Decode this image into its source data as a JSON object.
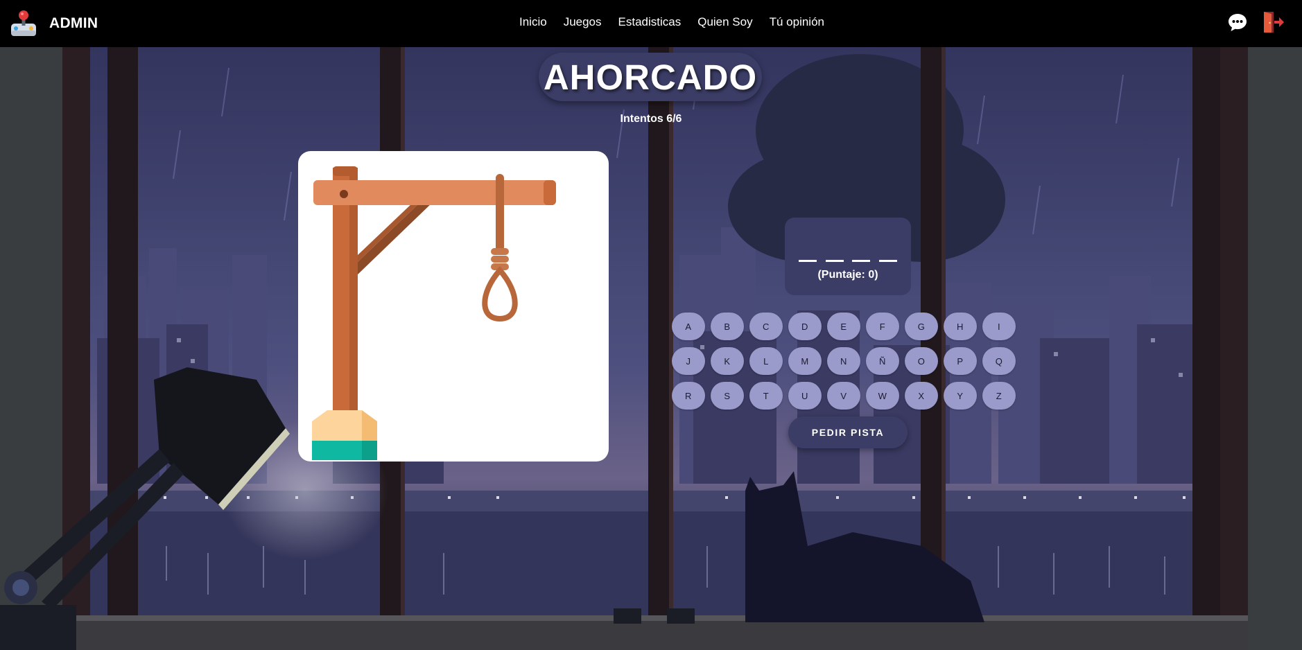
{
  "navbar": {
    "brand": "ADMIN",
    "brand_icon": "joystick-icon",
    "links": [
      "Inicio",
      "Juegos",
      "Estadisticas",
      "Quien Soy",
      "Tú opinión"
    ],
    "icons": [
      "chat-bubble-icon",
      "exit-door-icon"
    ],
    "accent_color": "#e23b3b"
  },
  "game": {
    "title": "AHORCADO",
    "attempts": "Intentos 6/6",
    "word_slots": 4,
    "score": "(Puntaje: 0)",
    "keyboard_rows": [
      [
        "A",
        "B",
        "C",
        "D",
        "E",
        "F",
        "G",
        "H",
        "I"
      ],
      [
        "J",
        "K",
        "L",
        "M",
        "N",
        "Ñ",
        "O",
        "P",
        "Q"
      ],
      [
        "R",
        "S",
        "T",
        "U",
        "V",
        "W",
        "X",
        "Y",
        "Z"
      ]
    ],
    "hint_button": "PEDIR PISTA"
  },
  "colors": {
    "panel": "#3c3d66",
    "key": "#9a9acb",
    "navbar": "#000000",
    "card": "#ffffff",
    "wood": "#c96a3a",
    "rope": "#b8673a"
  }
}
